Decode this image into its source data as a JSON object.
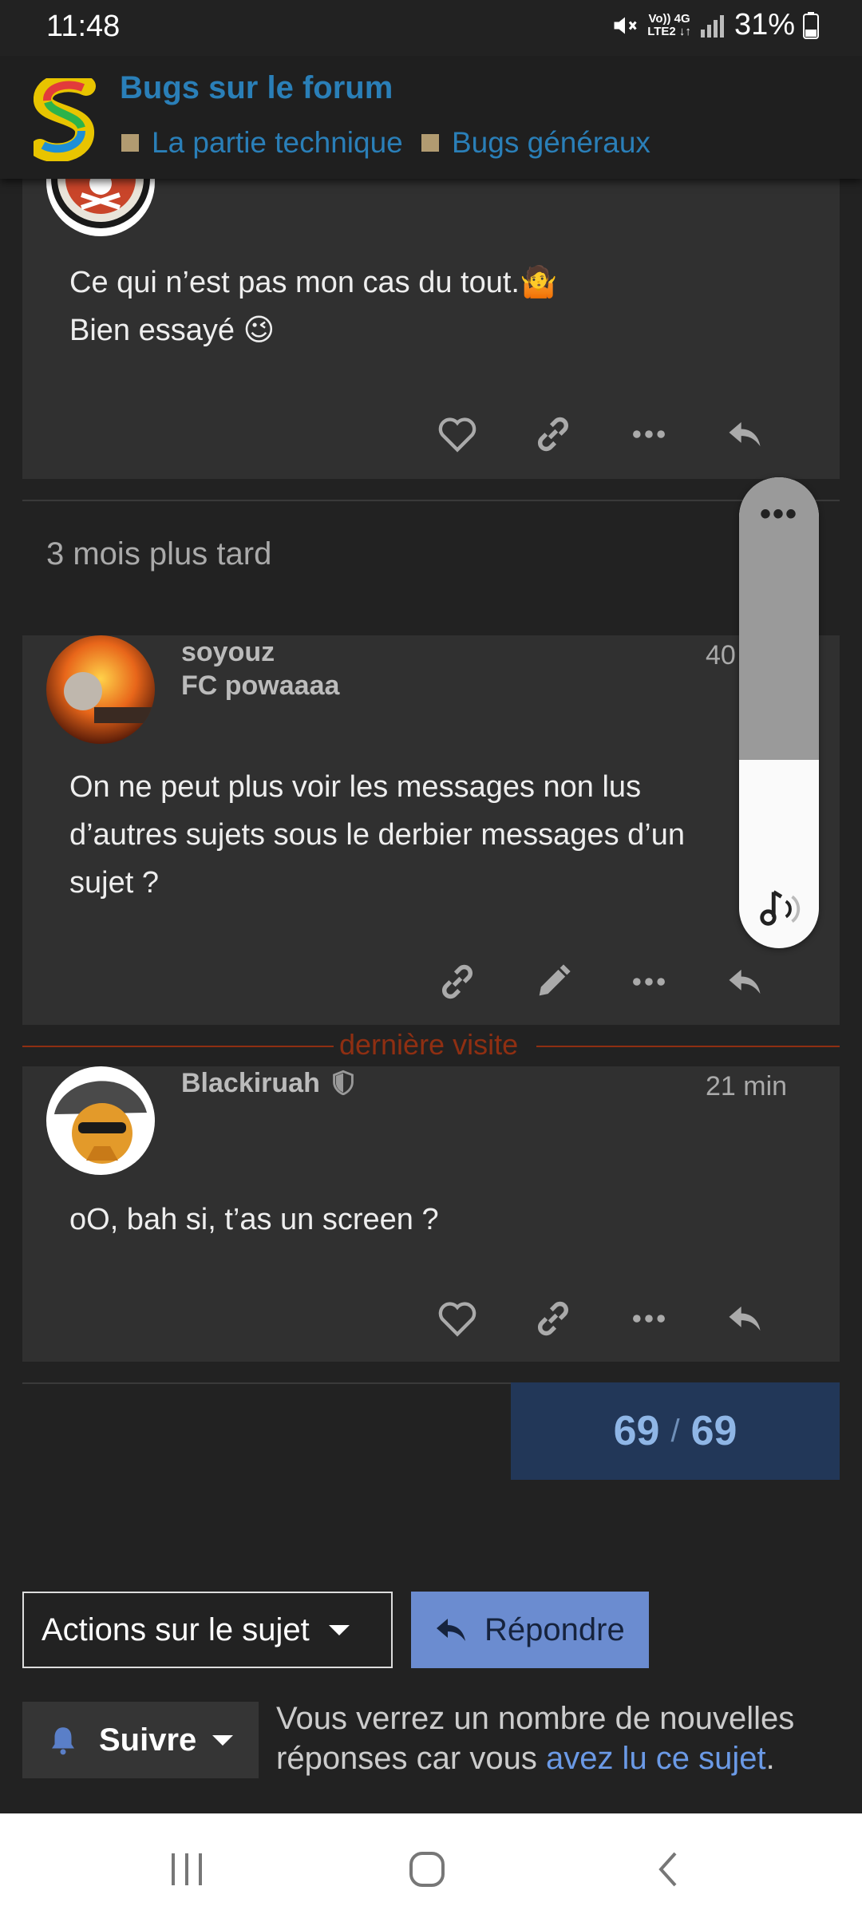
{
  "status_bar": {
    "time": "11:48",
    "signal_top": "Vo)) 4G",
    "signal_bottom": "LTE2 ↓↑",
    "battery": "31%"
  },
  "header": {
    "title": "Bugs sur le forum",
    "categories": [
      {
        "label": "La partie technique",
        "color": "#b19b71"
      },
      {
        "label": "Bugs généraux",
        "color": "#b19b71"
      }
    ]
  },
  "posts": [
    {
      "lines": [
        "Ce qui n’est pas mon cas du tout.🤷",
        "Bien essayé 😉"
      ],
      "actions": [
        "like-icon",
        "link-icon",
        "more-icon",
        "reply-icon"
      ]
    },
    {
      "time_gap": "3 mois plus tard",
      "username": "soyouz",
      "subname": "FC powaaaa",
      "time": "40",
      "lines": [
        "On ne peut plus voir les messages non lus",
        "d’autres sujets sous le derbier messages d’un",
        "sujet ?"
      ],
      "actions": [
        "link-icon",
        "edit-icon",
        "more-icon",
        "reply-icon"
      ]
    },
    {
      "username": "Blackiruah",
      "time": "21 min",
      "lines": [
        "oO, bah si, t’as un screen ?"
      ],
      "actions": [
        "like-icon",
        "link-icon",
        "more-icon",
        "reply-icon"
      ]
    }
  ],
  "last_visit_label": "dernière visite",
  "progress": {
    "current": "69",
    "separator": "/",
    "total": "69"
  },
  "footer": {
    "topic_actions_label": "Actions sur le sujet",
    "reply_label": "Répondre",
    "follow_label": "Suivre",
    "notification_text": "Vous verrez un nombre de nouvelles réponses car vous ",
    "notification_link": "avez lu ce sujet",
    "notification_end": "."
  },
  "volume_overlay": {
    "menu": "•••",
    "level": 0.4
  },
  "colors": {
    "accent_link": "#2a7fb8",
    "category": "#b19b71",
    "primary_button": "#6b8cd0",
    "last_visit": "#8f2f12"
  }
}
